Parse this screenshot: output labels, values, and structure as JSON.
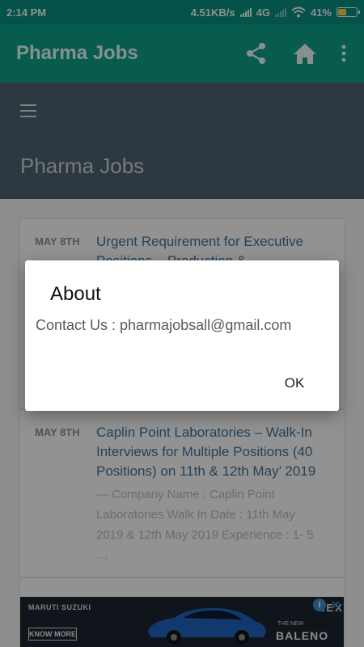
{
  "status_bar": {
    "time": "2:14 PM",
    "network_speed": "4.51KB/s",
    "network_type": "4G",
    "battery": "41%",
    "battery_level": 0.41
  },
  "app_bar": {
    "title": "Pharma Jobs",
    "icons": [
      "share-icon",
      "home-icon",
      "more-vert-icon"
    ],
    "color": "#0e9983"
  },
  "web_page": {
    "header_title": "Pharma Jobs",
    "menu_icon": "hamburger-menu-icon",
    "posts": [
      {
        "date": "MAY 8TH",
        "title_lines": [
          "Urgent Requirement for Executive",
          "Positions – Production &"
        ]
      },
      {
        "date": "MAY 8TH",
        "title_lines": [
          "Caplin Point Laboratories – Walk-In",
          "Interviews for Multiple Positions (40",
          "Positions) on 11th & 12th May’ 2019"
        ],
        "excerpt_lines": [
          "—  Company Name : Caplin Point",
          "Laboratories Walk In Date : 11th May",
          "2019 & 12th May 2019 Experience : 1- 5",
          "…"
        ]
      }
    ]
  },
  "ad_banner": {
    "brand": "MARUTI SUZUKI",
    "cta": "KNOW MORE",
    "tagline": "NEXA",
    "small_text": "THE NEW",
    "model": "BALENO",
    "info_icon": "info-icon",
    "close_icon": "close-icon"
  },
  "dialog": {
    "title": "About",
    "message": "Contact Us : pharmajobsall@gmail.com",
    "ok_label": "OK"
  }
}
